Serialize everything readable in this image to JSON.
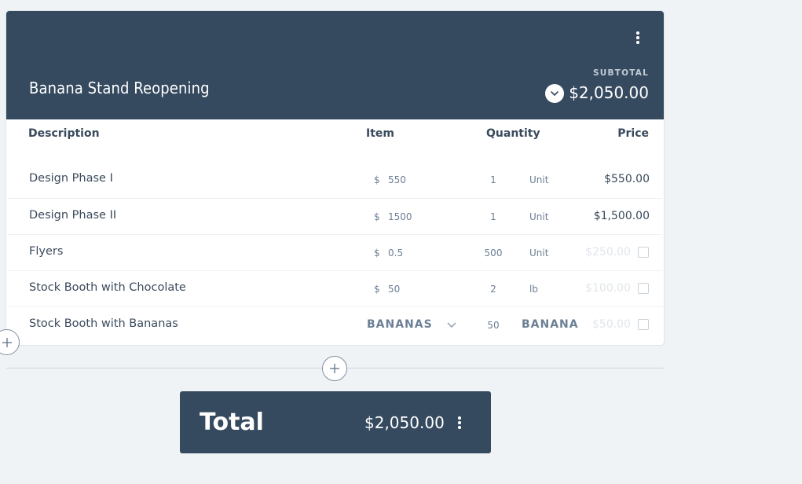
{
  "section": {
    "title": "Banana Stand Reopening",
    "subtotal_label": "SUBTOTAL",
    "subtotal_value": "$2,050.00"
  },
  "table": {
    "headers": {
      "description": "Description",
      "item": "Item",
      "quantity": "Quantity",
      "price": "Price"
    },
    "rows": [
      {
        "description": "Design Phase I",
        "currency": "$",
        "rate": "550",
        "qty": "1",
        "unit": "Unit",
        "price": "$550.00",
        "included": true
      },
      {
        "description": "Design Phase II",
        "currency": "$",
        "rate": "1500",
        "qty": "1",
        "unit": "Unit",
        "price": "$1,500.00",
        "included": true
      },
      {
        "description": "Flyers",
        "currency": "$",
        "rate": "0.5",
        "qty": "500",
        "unit": "Unit",
        "price": "$250.00",
        "included": false
      },
      {
        "description": "Stock Booth with Chocolate",
        "currency": "$",
        "rate": "50",
        "qty": "2",
        "unit": "lb",
        "price": "$100.00",
        "included": false
      },
      {
        "description": "Stock Booth with Bananas",
        "item_select": "BANANAS",
        "qty": "50",
        "unit": "BANANA",
        "price": "$50.00",
        "included": false
      }
    ]
  },
  "total": {
    "label": "Total",
    "value": "$2,050.00"
  },
  "colors": {
    "header_bg": "#35495f",
    "page_bg": "#f0f3f5"
  }
}
